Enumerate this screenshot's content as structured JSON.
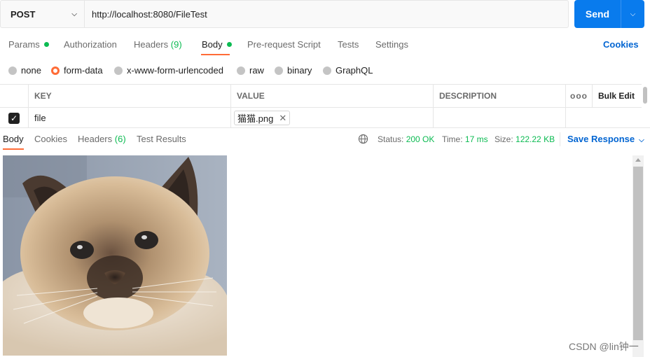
{
  "request": {
    "method": "POST",
    "url": "http://localhost:8080/FileTest",
    "send_label": "Send"
  },
  "tabs": {
    "params": "Params",
    "authorization": "Authorization",
    "headers": "Headers",
    "headers_count": "(9)",
    "body": "Body",
    "pre_request": "Pre-request Script",
    "tests": "Tests",
    "settings": "Settings",
    "cookies": "Cookies"
  },
  "body_types": {
    "none": "none",
    "form_data": "form-data",
    "urlencoded": "x-www-form-urlencoded",
    "raw": "raw",
    "binary": "binary",
    "graphql": "GraphQL",
    "selected": "form-data"
  },
  "table": {
    "headers": [
      "KEY",
      "VALUE",
      "DESCRIPTION"
    ],
    "more": "ooo",
    "bulk_edit": "Bulk Edit",
    "rows": [
      {
        "key": "file",
        "value": "猫猫.png",
        "description": "",
        "checked": true
      }
    ]
  },
  "response": {
    "tabs": {
      "body": "Body",
      "cookies": "Cookies",
      "headers": "Headers",
      "headers_count": "(6)",
      "test_results": "Test Results"
    },
    "status_label": "Status:",
    "status_value": "200 OK",
    "time_label": "Time:",
    "time_value": "17 ms",
    "size_label": "Size:",
    "size_value": "122.22 KB",
    "save_response": "Save Response"
  },
  "watermark": "CSDN @lin钟一",
  "colors": {
    "accent": "#ff6c37",
    "send": "#097bed",
    "link": "#0265d2",
    "success": "#0cbb52"
  }
}
